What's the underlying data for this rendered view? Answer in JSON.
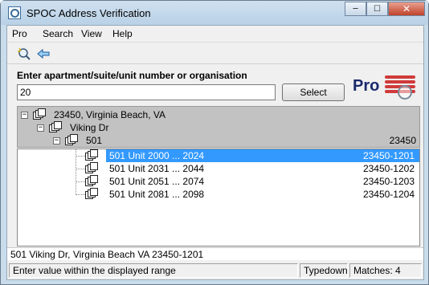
{
  "window": {
    "title": "SPOC Address Verification",
    "controls": {
      "minimize": "─",
      "maximize": "☐",
      "close": "✕"
    }
  },
  "menu": {
    "items": [
      "Pro",
      "Search",
      "View",
      "Help"
    ]
  },
  "toolbar": {
    "icons": [
      "search-icon",
      "back-arrow-icon"
    ]
  },
  "form": {
    "prompt": "Enter apartment/suite/unit number or organisation",
    "input_value": "20",
    "select_label": "Select"
  },
  "logo": {
    "text": "Pro"
  },
  "hierarchy": [
    {
      "label": "23450, Virginia Beach, VA",
      "code": ""
    },
    {
      "label": "Viking Dr",
      "code": ""
    },
    {
      "label": "501",
      "code": "23450"
    }
  ],
  "results": [
    {
      "range": "501 Unit 2000 ... 2024",
      "zip": "23450-1201",
      "selected": true
    },
    {
      "range": "501 Unit 2031 ... 2044",
      "zip": "23450-1202",
      "selected": false
    },
    {
      "range": "501 Unit 2051 ... 2074",
      "zip": "23450-1203",
      "selected": false
    },
    {
      "range": "501 Unit 2081 ... 2098",
      "zip": "23450-1204",
      "selected": false
    }
  ],
  "selected_address": "501 Viking Dr, Virginia Beach VA 23450-1201",
  "status": {
    "message": "Enter value within the displayed range",
    "mode": "Typedown",
    "matches": "Matches: 4"
  },
  "colors": {
    "selection": "#3399ff",
    "logo_text": "#1a2a6c",
    "logo_stripes": "#d03a3a"
  }
}
